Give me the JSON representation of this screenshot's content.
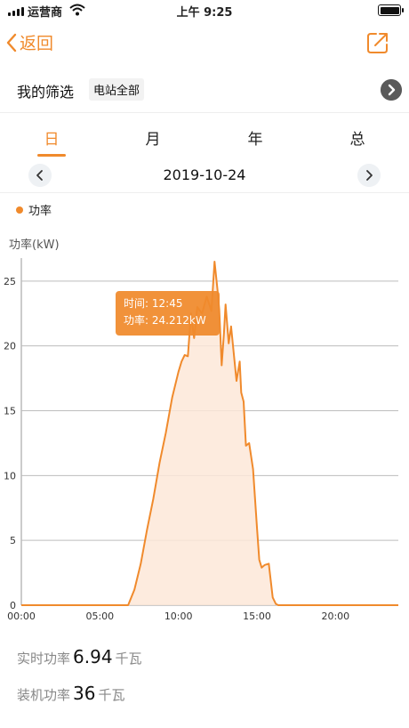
{
  "status_bar": {
    "carrier": "运营商",
    "time": "上午 9:25"
  },
  "nav": {
    "back_label": "返回",
    "icons": {
      "back": "chevron-left-icon",
      "share": "share-icon"
    }
  },
  "filter": {
    "label": "我的筛选",
    "chip": "电站全部"
  },
  "tabs": [
    "日",
    "月",
    "年",
    "总"
  ],
  "active_tab": 0,
  "date": "2019-10-24",
  "legend": {
    "label": "功率"
  },
  "colors": {
    "accent": "#f08a2c",
    "area_fill": "#fde8d8",
    "grid": "#bdbdbd"
  },
  "chart_data": {
    "type": "area",
    "ylabel": "功率(kW)",
    "ylim": [
      0,
      26.5
    ],
    "yticks": [
      0,
      5,
      10,
      15,
      20,
      25
    ],
    "xlim": [
      0,
      24
    ],
    "xticks": [
      "00:00",
      "05:00",
      "10:00",
      "15:00",
      "20:00"
    ],
    "series": [
      {
        "name": "功率",
        "x": [
          0,
          6.8,
          7.2,
          7.6,
          8.0,
          8.4,
          8.8,
          9.2,
          9.6,
          10.0,
          10.2,
          10.4,
          10.6,
          10.8,
          11.0,
          11.2,
          11.5,
          11.8,
          12.1,
          12.3,
          12.5,
          12.6,
          12.75,
          12.9,
          13.0,
          13.2,
          13.35,
          13.5,
          13.7,
          13.9,
          14.0,
          14.15,
          14.3,
          14.5,
          14.75,
          15.0,
          15.15,
          15.3,
          15.5,
          15.75,
          16.0,
          16.2,
          16.35,
          16.6,
          16.9,
          17.2,
          17.5,
          17.8,
          18.0,
          24.0
        ],
        "values": [
          0,
          0,
          1.2,
          3.2,
          5.8,
          8.2,
          11.0,
          13.3,
          16.0,
          18.0,
          18.8,
          19.3,
          19.2,
          22.5,
          20.6,
          23.0,
          22.5,
          23.8,
          22.7,
          26.5,
          24.2,
          22.8,
          18.5,
          21.0,
          23.2,
          20.2,
          21.5,
          19.7,
          17.3,
          18.8,
          16.4,
          15.7,
          12.3,
          12.5,
          10.5,
          6.0,
          3.5,
          2.9,
          3.1,
          3.2,
          0.6,
          0.1,
          0,
          0,
          0,
          0,
          0,
          0,
          0,
          0
        ]
      }
    ],
    "tooltip": {
      "time_label": "时间:",
      "time": "12:45",
      "power_label": "功率:",
      "power": "24.212kW"
    }
  },
  "stats": {
    "realtime": {
      "label": "实时功率",
      "value": "6.94",
      "unit": "千瓦"
    },
    "installed": {
      "label": "装机功率",
      "value": "36",
      "unit": "千瓦"
    }
  }
}
